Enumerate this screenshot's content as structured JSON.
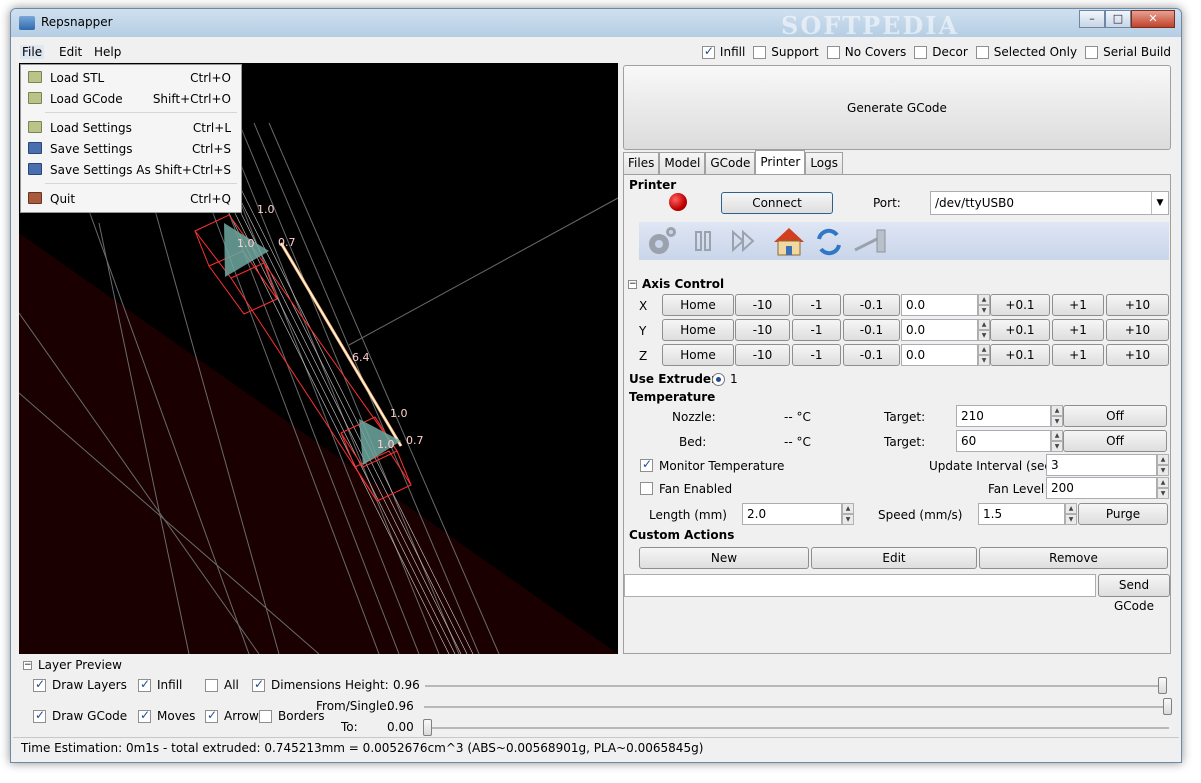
{
  "window": {
    "title": "Repsnapper",
    "watermark": "SOFTPEDIA",
    "controls": {
      "minimize": "–",
      "maximize": "□",
      "close": "✕"
    }
  },
  "menubar": {
    "file": "File",
    "edit": "Edit",
    "help": "Help"
  },
  "top_checks": [
    {
      "label": "Infill",
      "checked": true
    },
    {
      "label": "Support",
      "checked": false
    },
    {
      "label": "No Covers",
      "checked": false
    },
    {
      "label": "Decor",
      "checked": false
    },
    {
      "label": "Selected Only",
      "checked": false
    },
    {
      "label": "Serial Build",
      "checked": false
    }
  ],
  "file_menu": [
    {
      "label": "Load STL",
      "shortcut": "Ctrl+O",
      "icon": "folder-icon"
    },
    {
      "label": "Load GCode",
      "shortcut": "Shift+Ctrl+O",
      "icon": "folder-icon"
    },
    {
      "label": "Load Settings",
      "shortcut": "Ctrl+L",
      "icon": "folder-icon"
    },
    {
      "label": "Save Settings",
      "shortcut": "Ctrl+S",
      "icon": "disk-icon"
    },
    {
      "label": "Save Settings As",
      "shortcut": "Shift+Ctrl+S",
      "icon": "disk-icon"
    },
    {
      "label": "Quit",
      "shortcut": "Ctrl+Q",
      "icon": "quit-icon"
    }
  ],
  "viewport": {
    "labels": [
      "1.0",
      "1.0",
      "0.7",
      "6.4",
      "1.0",
      "1.0",
      "0.7"
    ]
  },
  "generate_button": "Generate GCode",
  "tabs": [
    "Files",
    "Model",
    "GCode",
    "Printer",
    "Logs"
  ],
  "printer": {
    "section_title": "Printer",
    "connect_label": "Connect",
    "port_label": "Port:",
    "port_value": "/dev/ttyUSB0",
    "toolbar_icons": [
      "settings-gear-icon",
      "pause-icon",
      "fast-forward-icon",
      "home-icon",
      "refresh-icon",
      "extruder-icon"
    ],
    "axis_title": "Axis Control",
    "axes": [
      {
        "name": "X",
        "value": "0.0"
      },
      {
        "name": "Y",
        "value": "0.0"
      },
      {
        "name": "Z",
        "value": "0.0"
      }
    ],
    "axis_buttons": {
      "home": "Home",
      "m10": "-10",
      "m1": "-1",
      "m01": "-0.1",
      "p01": "+0.1",
      "p1": "+1",
      "p10": "+10"
    },
    "use_extruder_label": "Use Extruder:",
    "extruder_value": "1",
    "temperature_title": "Temperature",
    "nozzle_label": "Nozzle:",
    "nozzle_value": "-- °C",
    "bed_label": "Bed:",
    "bed_value": "-- °C",
    "target_label": "Target:",
    "nozzle_target": "210",
    "bed_target": "60",
    "off_label": "Off",
    "monitor_label": "Monitor Temperature",
    "monitor_checked": true,
    "update_interval_label": "Update Interval (sec)",
    "update_interval_value": "3",
    "fan_label": "Fan Enabled",
    "fan_checked": false,
    "fan_level_label": "Fan Level",
    "fan_level_value": "200",
    "length_label": "Length (mm)",
    "length_value": "2.0",
    "speed_label": "Speed (mm/s)",
    "speed_value": "1.5",
    "purge_label": "Purge",
    "custom_actions_title": "Custom Actions",
    "new_label": "New",
    "edit_label": "Edit",
    "remove_label": "Remove",
    "gcode_input_value": "",
    "send_gcode_label": "Send GCode"
  },
  "layer_preview": {
    "title": "Layer Preview",
    "draw_layers": {
      "label": "Draw Layers",
      "checked": true
    },
    "infill": {
      "label": "Infill",
      "checked": true
    },
    "all": {
      "label": "All",
      "checked": false
    },
    "dimensions": {
      "label": "Dimensions",
      "checked": true
    },
    "height_label": "Height:",
    "height_value": "0.96",
    "draw_gcode": {
      "label": "Draw GCode",
      "checked": true
    },
    "moves": {
      "label": "Moves",
      "checked": true
    },
    "arrows": {
      "label": "Arrows",
      "checked": true
    },
    "borders": {
      "label": "Borders",
      "checked": false
    },
    "from_single_label": "From/Single:",
    "from_single_value": "0.96",
    "to_label": "To:",
    "to_value": "0.00"
  },
  "status_bar": "Time Estimation: 0m1s - total extruded: 0.745213mm = 0.0052676cm^3 (ABS~0.00568901g, PLA~0.0065845g)"
}
